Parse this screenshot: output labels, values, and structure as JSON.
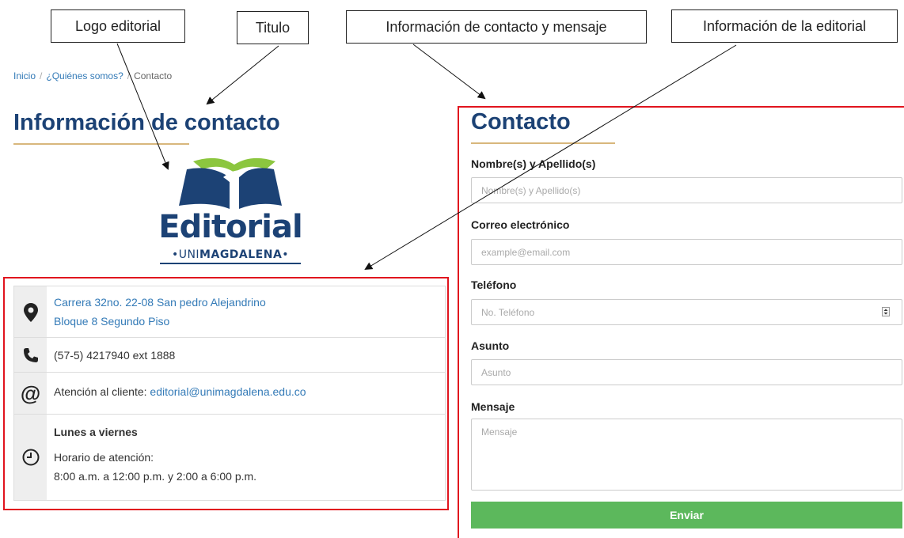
{
  "annotations": {
    "logo": "Logo editorial",
    "title": "Titulo",
    "contact_form": "Información de contacto y mensaje",
    "editorial_info": "Información de la editorial"
  },
  "breadcrumb": {
    "items": [
      "Inicio",
      "¿Quiénes somos?",
      "Contacto"
    ],
    "separator": "/"
  },
  "left": {
    "title": "Información de contacto",
    "logo": {
      "word": "Editorial",
      "sub_pre": "•UNI",
      "sub_bold": "MAGDALENA",
      "sub_post": "•"
    },
    "address": {
      "line1": "Carrera 32no. 22-08 San pedro Alejandrino",
      "line2": "Bloque 8 Segundo Piso"
    },
    "phone": "(57-5) 4217940 ext 1888",
    "email": {
      "prefix": "Atención al cliente: ",
      "address": "editorial@unimagdalena.edu.co"
    },
    "hours": {
      "days": "Lunes a viernes",
      "label": "Horario de atención:",
      "times": "8:00 a.m. a 12:00 p.m. y 2:00 a 6:00 p.m."
    }
  },
  "form": {
    "title": "Contacto",
    "name": {
      "label": "Nombre(s) y Apellido(s)",
      "placeholder": "Nombre(s) y Apellido(s)"
    },
    "email": {
      "label": "Correo electrónico",
      "placeholder": "example@email.com"
    },
    "phone": {
      "label": "Teléfono",
      "placeholder": "No. Teléfono"
    },
    "subject": {
      "label": "Asunto",
      "placeholder": "Asunto"
    },
    "message": {
      "label": "Mensaje",
      "placeholder": "Mensaje"
    },
    "submit": "Enviar"
  },
  "colors": {
    "brand_blue": "#1c4275",
    "link_blue": "#337ab7",
    "accent_gold": "#d8b77c",
    "highlight_red": "#e1141e",
    "submit_green": "#5cb85c"
  },
  "icons": [
    "map-marker-icon",
    "phone-icon",
    "at-sign-icon",
    "clock-icon",
    "spinner-arrows-icon"
  ]
}
